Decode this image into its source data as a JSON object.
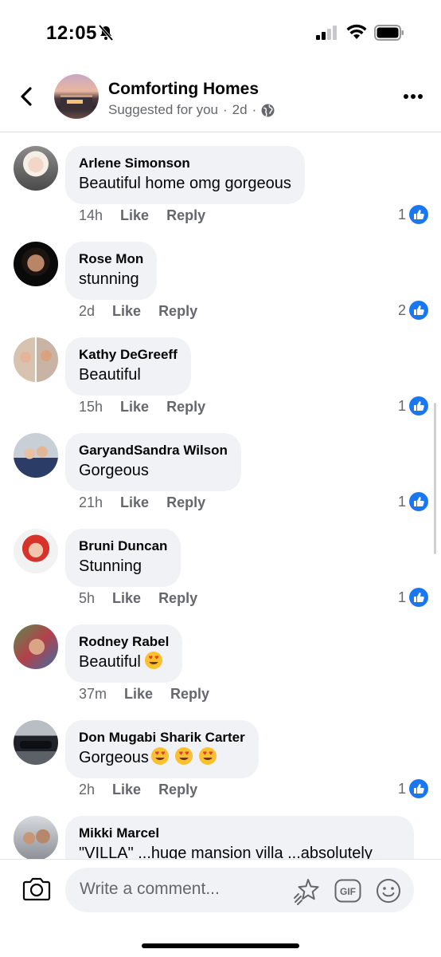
{
  "status_bar": {
    "time": "12:05"
  },
  "header": {
    "title": "Comforting Homes",
    "subtitle": "Suggested for you",
    "time": "2d"
  },
  "comments": [
    {
      "name": "Arlene Simonson",
      "text": "Beautiful home omg gorgeous",
      "time": "14h",
      "like": "Like",
      "reply": "Reply",
      "likes": "1"
    },
    {
      "name": "Rose Mon",
      "text": "stunning",
      "time": "2d",
      "like": "Like",
      "reply": "Reply",
      "likes": "2"
    },
    {
      "name": "Kathy DeGreeff",
      "text": "Beautiful",
      "time": "15h",
      "like": "Like",
      "reply": "Reply",
      "likes": "1"
    },
    {
      "name": "GaryandSandra Wilson",
      "text": "Gorgeous",
      "time": "21h",
      "like": "Like",
      "reply": "Reply",
      "likes": "1"
    },
    {
      "name": "Bruni Duncan",
      "text": "Stunning",
      "time": "5h",
      "like": "Like",
      "reply": "Reply",
      "likes": "1"
    },
    {
      "name": "Rodney Rabel",
      "text": "Beautiful",
      "time": "37m",
      "like": "Like",
      "reply": "Reply",
      "likes": ""
    },
    {
      "name": "Don Mugabi Sharik Carter",
      "text": "Gorgeous",
      "time": "2h",
      "like": "Like",
      "reply": "Reply",
      "likes": "1"
    },
    {
      "name": "Mikki Marcel",
      "text": "\"VILLA\" ...huge mansion villa ...absolutely"
    }
  ],
  "composer": {
    "placeholder": "Write a comment...",
    "gif_label": "GIF"
  },
  "colors": {
    "accent": "#1877f2",
    "bubble": "#f0f2f5",
    "secondary_text": "#65676b"
  }
}
